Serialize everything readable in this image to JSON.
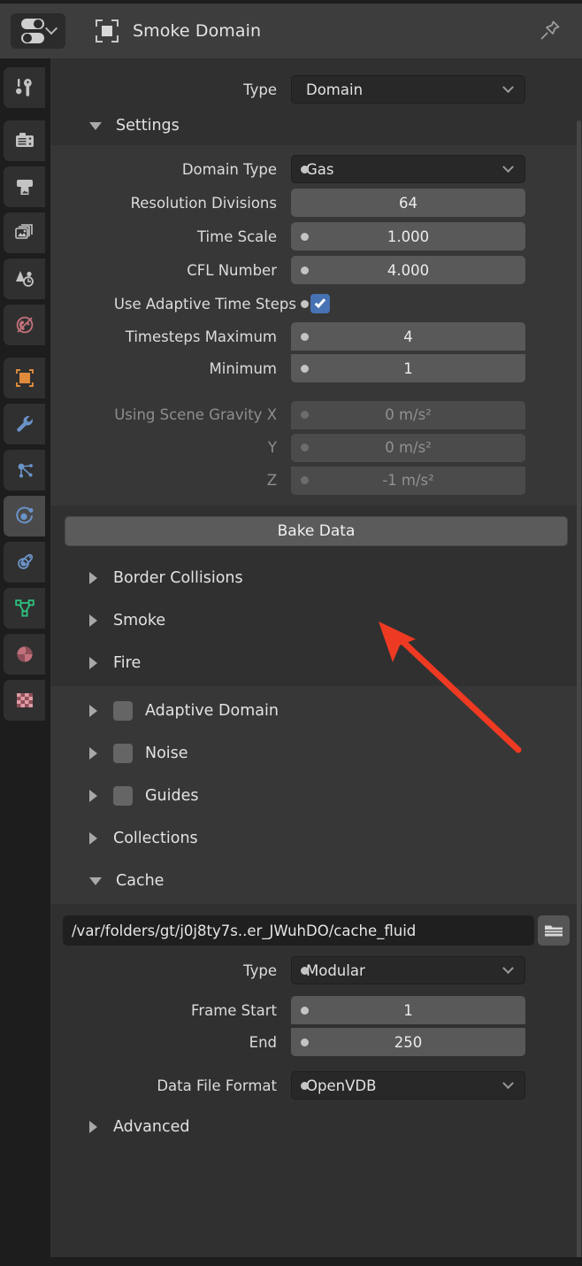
{
  "header": {
    "title": "Smoke Domain",
    "editor_selector_icon": "properties-editor-icon",
    "object_icon": "object-data-icon",
    "pin_icon": "pin-icon"
  },
  "tabs": [
    {
      "name": "tool",
      "icon": "tool-icon",
      "active": false
    },
    {
      "name": "render",
      "icon": "camera-back-icon",
      "active": false
    },
    {
      "name": "output",
      "icon": "printer-icon",
      "active": false
    },
    {
      "name": "view-layer",
      "icon": "images-icon",
      "active": false
    },
    {
      "name": "scene",
      "icon": "scene-cone-icon",
      "active": false
    },
    {
      "name": "world",
      "icon": "world-globe-icon",
      "active": false
    },
    {
      "name": "object",
      "icon": "object-square-icon",
      "active": false
    },
    {
      "name": "modifiers",
      "icon": "wrench-icon",
      "active": false
    },
    {
      "name": "particles",
      "icon": "particles-icon",
      "active": false
    },
    {
      "name": "physics",
      "icon": "physics-orbit-icon",
      "active": true
    },
    {
      "name": "object-constraints",
      "icon": "constraint-icon",
      "active": false
    },
    {
      "name": "object-data",
      "icon": "mesh-data-icon",
      "active": false
    },
    {
      "name": "material",
      "icon": "material-sphere-icon",
      "active": false
    },
    {
      "name": "texture",
      "icon": "checker-texture-icon",
      "active": false
    }
  ],
  "type_row": {
    "label": "Type",
    "value": "Domain"
  },
  "settings_panel": {
    "label": "Settings",
    "expanded": true,
    "rows": [
      {
        "label": "Domain Type",
        "value": "Gas",
        "kind": "dropdown",
        "decorator": true
      },
      {
        "label": "Resolution Divisions",
        "value": "64",
        "kind": "number",
        "decorator": false
      },
      {
        "label": "Time Scale",
        "value": "1.000",
        "kind": "number",
        "decorator": true
      },
      {
        "label": "CFL Number",
        "value": "4.000",
        "kind": "number",
        "decorator": true
      }
    ],
    "adaptive_checkbox": {
      "label": "Use Adaptive Time Steps",
      "checked": true,
      "decorator": true
    },
    "timestep_rows": [
      {
        "label": "Timesteps Maximum",
        "value": "4",
        "decorator": true
      },
      {
        "label": "Minimum",
        "value": "1",
        "decorator": true
      }
    ],
    "gravity_rows": [
      {
        "label": "Using Scene Gravity X",
        "value": "0 m/s²",
        "decorator": true
      },
      {
        "label": "Y",
        "value": "0 m/s²",
        "decorator": true
      },
      {
        "label": "Z",
        "value": "-1 m/s²",
        "decorator": true
      }
    ]
  },
  "bake_button": {
    "label": "Bake Data"
  },
  "sub_panels": [
    {
      "label": "Border Collisions",
      "expanded": false,
      "checkbox": false
    },
    {
      "label": "Smoke",
      "expanded": false,
      "checkbox": false
    },
    {
      "label": "Fire",
      "expanded": false,
      "checkbox": false
    },
    {
      "label": "Adaptive Domain",
      "expanded": false,
      "checkbox": true
    },
    {
      "label": "Noise",
      "expanded": false,
      "checkbox": true
    },
    {
      "label": "Guides",
      "expanded": false,
      "checkbox": true
    },
    {
      "label": "Collections",
      "expanded": false,
      "checkbox": false
    }
  ],
  "cache_panel": {
    "label": "Cache",
    "expanded": true,
    "path": "/var/folders/gt/j0j8ty7s..er_JWuhDO/cache_fluid",
    "folder_icon": "folder-icon",
    "rows": [
      {
        "label": "Type",
        "value": "Modular",
        "kind": "dropdown",
        "decorator": true
      },
      {
        "label": "Frame Start",
        "value": "1",
        "kind": "number",
        "decorator": true
      },
      {
        "label": "End",
        "value": "250",
        "kind": "number",
        "decorator": true
      },
      {
        "label": "Data File Format",
        "value": "OpenVDB",
        "kind": "dropdown",
        "decorator": true
      }
    ]
  },
  "advanced_panel": {
    "label": "Advanced",
    "expanded": false
  },
  "annotation": {
    "arrow_color": "#ee3a22",
    "points_to": "bake-data-button"
  },
  "colors": {
    "panel_bg": "#303030",
    "panel_bg_alt": "#373737",
    "header_bg": "#3d3d3d",
    "field_number": "#595959",
    "field_dropdown": "#282828",
    "accent_checkbox": "#4772b3",
    "text": "#dcdcdc"
  }
}
